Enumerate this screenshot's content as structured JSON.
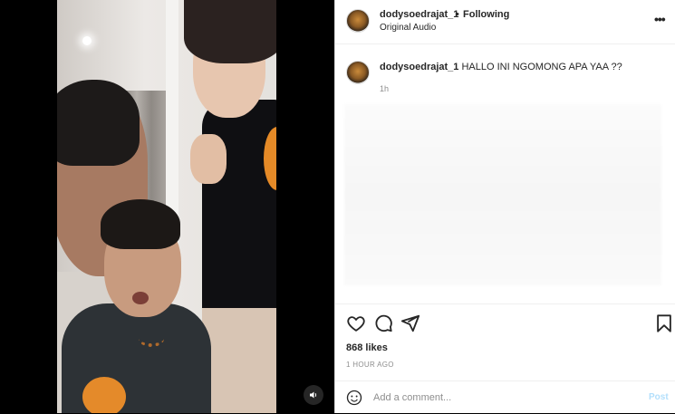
{
  "post": {
    "username": "dodysoedrajat_1",
    "separator": "•",
    "follow_state": "Following",
    "audio": "Original Audio",
    "more_label": "•••"
  },
  "caption": {
    "username": "dodysoedrajat_1",
    "text": "HALLO INI NGOMONG APA YAA ??",
    "time": "1h"
  },
  "stats": {
    "likes": "868 likes",
    "posted": "1 HOUR AGO"
  },
  "comment_box": {
    "placeholder": "Add a comment...",
    "post_label": "Post"
  },
  "icons": {
    "like": "heart-icon",
    "comment": "comment-bubble-icon",
    "share": "paper-plane-icon",
    "save": "bookmark-icon",
    "emoji": "smiley-icon",
    "audio": "speaker-icon",
    "more": "more-options-icon"
  },
  "colors": {
    "post_button": "#b2dffc",
    "secondary_text": "#8e8e8e",
    "primary_text": "#262626"
  }
}
